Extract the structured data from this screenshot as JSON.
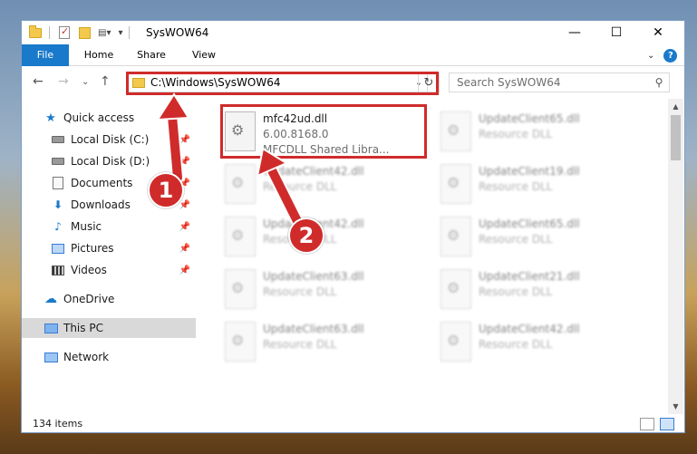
{
  "window": {
    "title": "SysWOW64",
    "controls": {
      "minimize": "—",
      "maximize": "☐",
      "close": "✕"
    }
  },
  "ribbon": {
    "tabs": [
      {
        "label": "File"
      },
      {
        "label": "Home"
      },
      {
        "label": "Share"
      },
      {
        "label": "View"
      }
    ],
    "help": "?"
  },
  "navigation": {
    "address": "C:\\Windows\\SysWOW64",
    "search_placeholder": "Search SysWOW64"
  },
  "sidebar": {
    "items": [
      {
        "label": "Quick access"
      },
      {
        "label": "Local Disk (C:)"
      },
      {
        "label": "Local Disk (D:)"
      },
      {
        "label": "Documents"
      },
      {
        "label": "Downloads"
      },
      {
        "label": "Music"
      },
      {
        "label": "Pictures"
      },
      {
        "label": "Videos"
      },
      {
        "label": "OneDrive"
      },
      {
        "label": "This PC"
      },
      {
        "label": "Network"
      }
    ]
  },
  "files": [
    {
      "name": "mfc42ud.dll",
      "version": "6.00.8168.0",
      "description": "MFCDLL Shared Libra..."
    },
    {
      "name": "UpdateClient65.dll",
      "description": "Resource DLL"
    },
    {
      "name": "UpdateClient42.dll",
      "description": "Resource DLL"
    },
    {
      "name": "UpdateClient19.dll",
      "description": "Resource DLL"
    },
    {
      "name": "UpdateClient42.dll",
      "description": "Resource DLL"
    },
    {
      "name": "UpdateClient65.dll",
      "description": "Resource DLL"
    },
    {
      "name": "UpdateClient63.dll",
      "description": "Resource DLL"
    },
    {
      "name": "UpdateClient21.dll",
      "description": "Resource DLL"
    },
    {
      "name": "UpdateClient63.dll",
      "description": "Resource DLL"
    },
    {
      "name": "UpdateClient42.dll",
      "description": "Resource DLL"
    }
  ],
  "status": {
    "item_count": "134 items"
  },
  "annotations": {
    "step1": "1",
    "step2": "2",
    "color": "#d02b2b"
  }
}
